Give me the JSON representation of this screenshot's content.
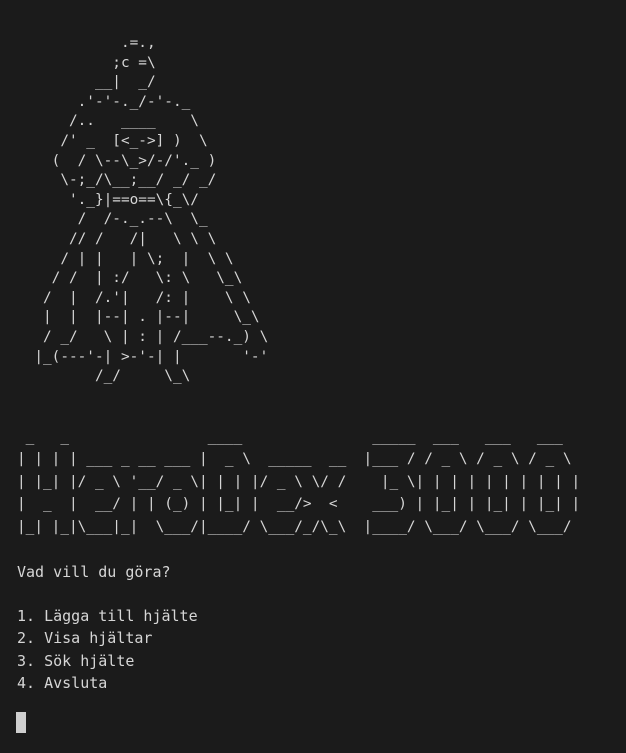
{
  "terminal": {
    "hero_ascii": "            .=.,\n           ;c =\\\n         __|  _/\n       .'-'-._/-'-._\n      /..   ____    \\\n     /' _  [<_->] )  \\\n    (  / \\--\\_>/-/'._ )\n     \\-;_/\\__;__/ _/ _/\n      '._}|==o==\\{_\\/\n       /  /-._.--\\  \\_\n      // /   /|   \\ \\ \\\n     / | |   | \\;  |  \\ \\\n    / /  | :/   \\: \\   \\_\\\n   /  |  /.'|   /: |    \\ \\\n   |  |  |--| . |--|     \\_\\\n   / _/   \\ | : | /___--._) \\\n  |_(---'-| >-'-| |       '-'\n         /_/     \\_\\",
    "logo_ascii": " _   _                ____               _____  ___   ___   ___\n| | | | ___ _ __ ___ |  _ \\  _____  __  |___ / / _ \\ / _ \\ / _ \\\n| |_| |/ _ \\ '__/ _ \\| | | |/ _ \\ \\/ /    |_ \\| | | | | | | | | |\n|  _  |  __/ | | (_) | |_| |  __/>  <    ___) | |_| | |_| | |_| |\n|_| |_|\\___|_|  \\___/|____/ \\___/_/\\_\\  |____/ \\___/ \\___/ \\___/",
    "question": "Vad vill du göra?",
    "menu": [
      "1. Lägga till hjälte",
      "2. Visa hjältar",
      "3. Sök hjälte",
      "4. Avsluta"
    ],
    "colors": {
      "background": "#1b1b1b",
      "text": "#d6d6d6",
      "cursor": "#cfcfcf"
    }
  }
}
